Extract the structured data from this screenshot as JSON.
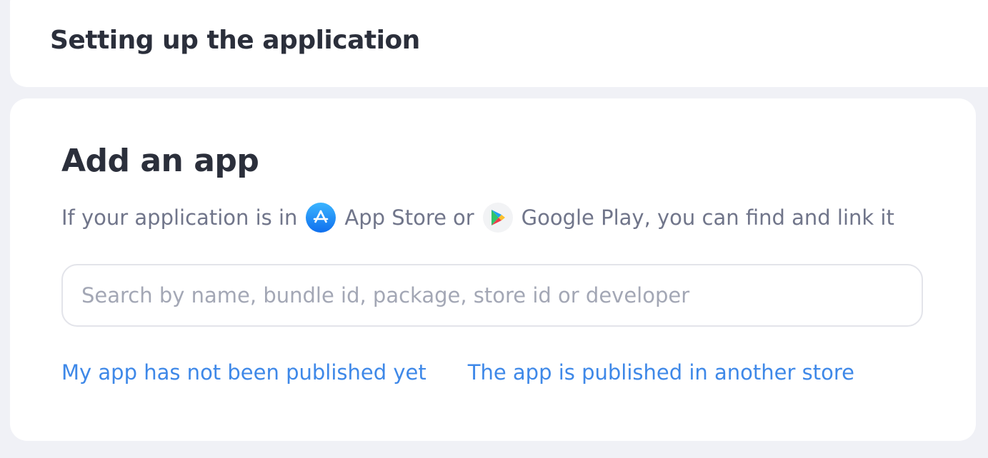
{
  "header": {
    "title": "Setting up the application"
  },
  "add_app": {
    "heading": "Add an app",
    "description_prefix": "If your application is in",
    "app_store_label": "App Store",
    "connector": "or",
    "google_play_label": "Google Play, you can find and link it",
    "search": {
      "placeholder": "Search by name, bundle id, package, store id or developer",
      "value": ""
    },
    "links": {
      "not_published": "My app has not been published yet",
      "other_store": "The app is published in another store"
    }
  },
  "icons": {
    "app_store": "app-store-icon",
    "google_play": "google-play-icon"
  },
  "colors": {
    "background": "#f0f1f6",
    "card": "#ffffff",
    "heading": "#2b2f3b",
    "body_text": "#70758a",
    "placeholder": "#a3a7b5",
    "link": "#3e88e8"
  }
}
